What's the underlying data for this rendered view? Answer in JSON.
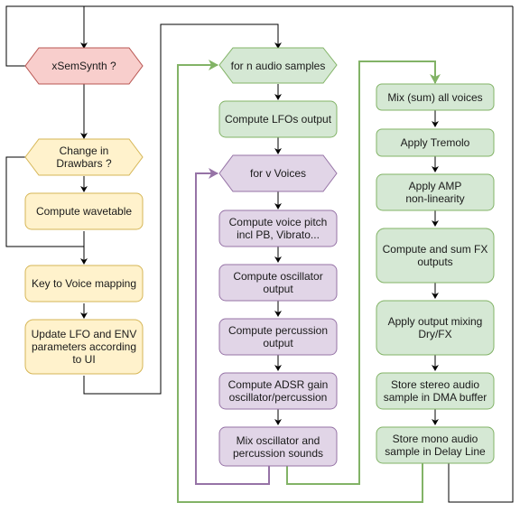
{
  "diagram": {
    "colors": {
      "red_fill": "#f8cecc",
      "red_stroke": "#b85450",
      "yellow_fill": "#fff2cc",
      "yellow_stroke": "#d6b656",
      "green_fill": "#d5e8d4",
      "green_stroke": "#82b366",
      "purple_fill": "#e1d5e7",
      "purple_stroke": "#9673a6",
      "edge_black": "#000000",
      "edge_green": "#82b366",
      "edge_purple": "#9673a6"
    },
    "nodes": {
      "xsemsynth": "xSemSynth ?",
      "change_drawbars": "Change in\nDrawbars ?",
      "compute_wavetable": "Compute wavetable",
      "key_voice_mapping": "Key to Voice mapping",
      "update_lfo_env": "Update LFO and ENV\nparameters according\nto UI",
      "for_n_samples": "for n audio samples",
      "compute_lfos": "Compute LFOs output",
      "for_v_voices": "for v Voices",
      "voice_pitch": "Compute voice pitch\nincl PB, Vibrato...",
      "osc_output": "Compute oscillator\noutput",
      "perc_output": "Compute percussion\noutput",
      "adsr_gain": "Compute ADSR gain\noscillator/percussion",
      "mix_osc_perc": "Mix oscillator and\npercussion sounds",
      "mix_all_voices": "Mix (sum) all voices",
      "apply_tremolo": "Apply Tremolo",
      "apply_amp": "Apply AMP\nnon-linearity",
      "compute_fx": "Compute and sum FX\noutputs",
      "output_mixing": "Apply output mixing\nDry/FX",
      "store_stereo": "Store stereo audio\nsample in DMA buffer",
      "store_mono": "Store mono audio\nsample in Delay Line"
    }
  }
}
